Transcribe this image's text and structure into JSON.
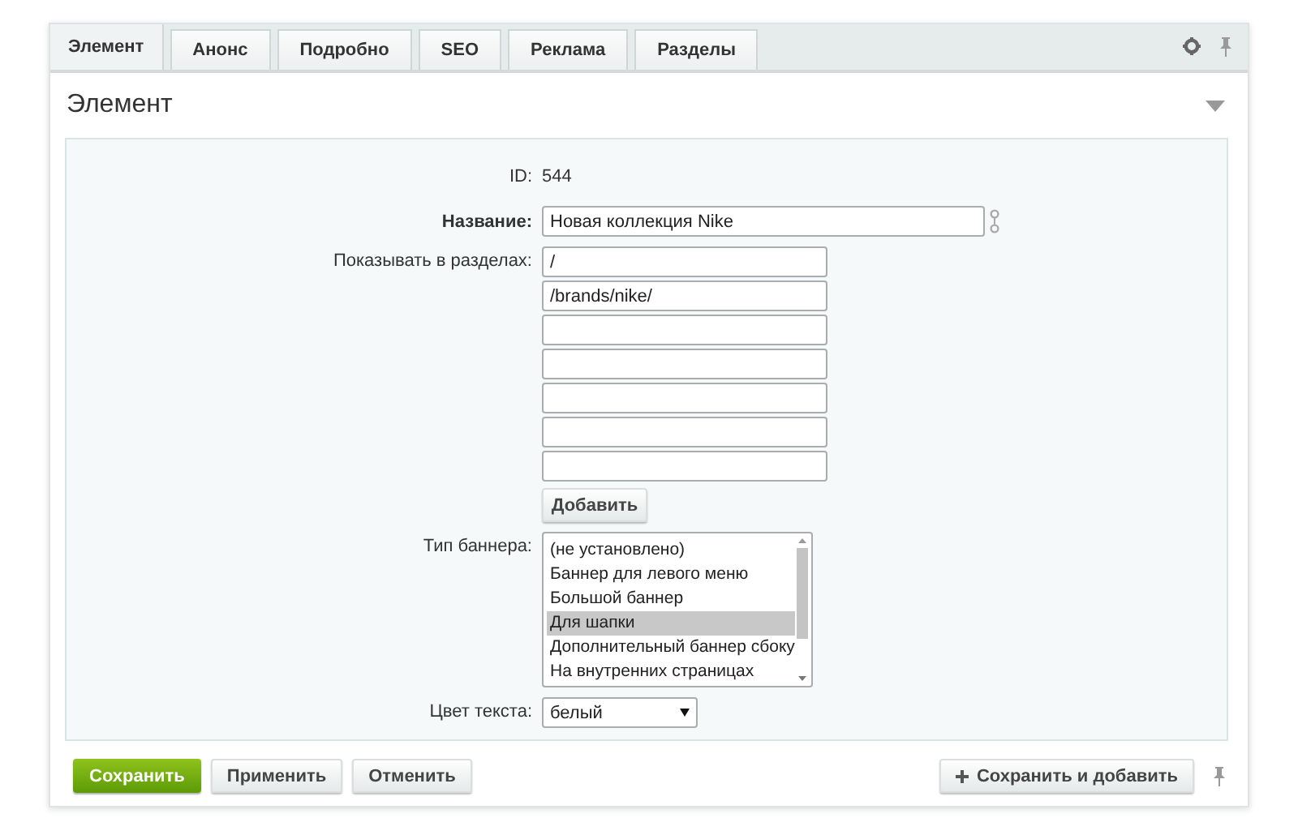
{
  "tabs": [
    {
      "label": "Элемент",
      "selected": true
    },
    {
      "label": "Анонс",
      "selected": false
    },
    {
      "label": "Подробно",
      "selected": false
    },
    {
      "label": "SEO",
      "selected": false
    },
    {
      "label": "Реклама",
      "selected": false
    },
    {
      "label": "Разделы",
      "selected": false
    }
  ],
  "section": {
    "title": "Элемент",
    "expanded": true
  },
  "form": {
    "id_label": "ID:",
    "id_value": "544",
    "name_label": "Название:",
    "name_value": "Новая коллекция Nike",
    "sections_label": "Показывать в разделах:",
    "sections": [
      {
        "kind": "filled",
        "value": "/"
      },
      {
        "kind": "filled",
        "value": "/brands/nike/"
      },
      {
        "kind": "empty"
      },
      {
        "kind": "empty"
      },
      {
        "kind": "empty"
      },
      {
        "kind": "empty"
      },
      {
        "kind": "empty"
      }
    ],
    "add_button": "Добавить",
    "banner_label": "Тип баннера:",
    "banner_options": [
      {
        "label": "(не установлено)",
        "selected": false
      },
      {
        "label": "Баннер для левого меню",
        "selected": false
      },
      {
        "label": "Большой баннер",
        "selected": false
      },
      {
        "label": "Для шапки",
        "selected": true
      },
      {
        "label": "Дополнительный баннер сбоку",
        "selected": false
      },
      {
        "label": "На внутренних страницах",
        "selected": false
      }
    ],
    "color_label": "Цвет текста:",
    "color_value": "белый"
  },
  "buttons": {
    "save": "Сохранить",
    "apply": "Применить",
    "cancel": "Отменить",
    "save_add": "Сохранить и добавить"
  }
}
